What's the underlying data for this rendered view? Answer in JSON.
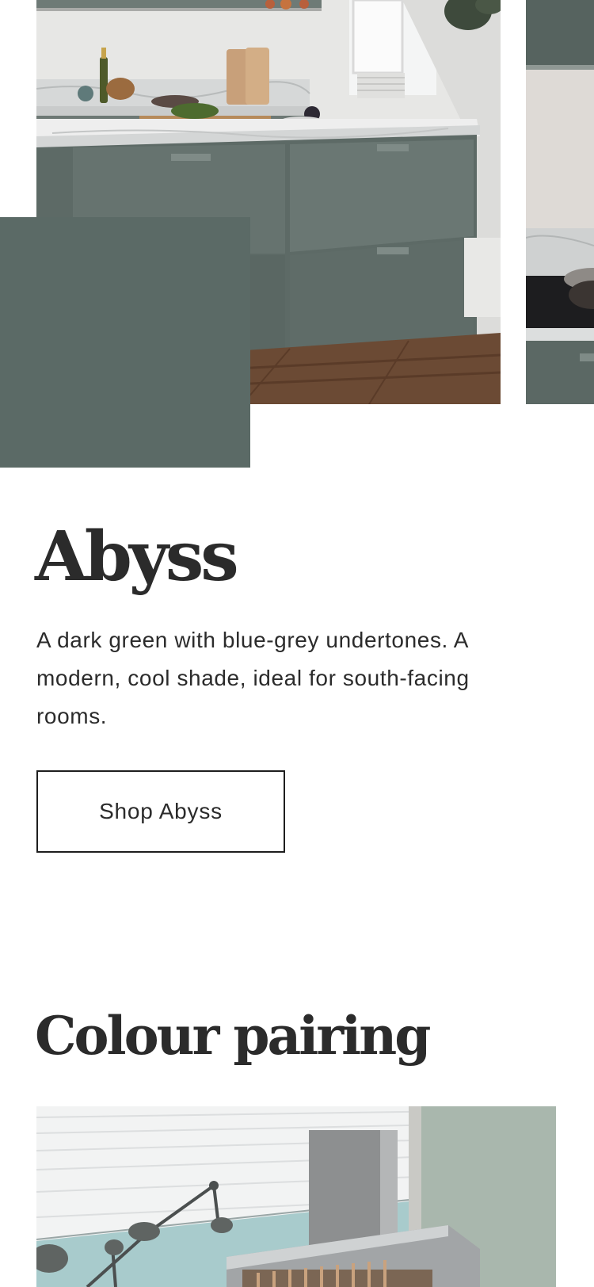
{
  "colour": {
    "name": "Abyss",
    "description": "A dark green with blue-grey undertones. A modern, cool shade, ideal for south-facing rooms.",
    "swatch_hex": "#5b6a66",
    "shop_label": "Shop Abyss"
  },
  "pairing": {
    "heading": "Colour pairing"
  }
}
